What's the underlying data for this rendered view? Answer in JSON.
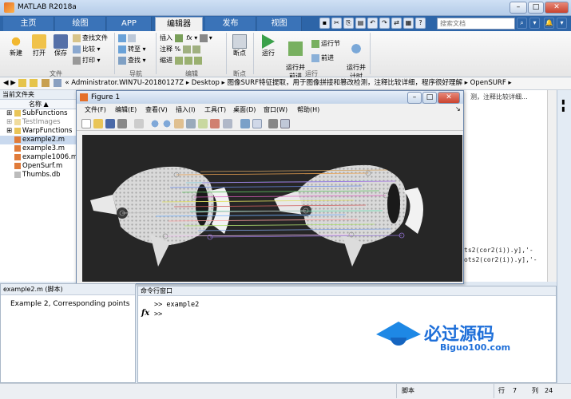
{
  "app": {
    "title": "MATLAB R2018a"
  },
  "tabs": [
    {
      "label": "主页"
    },
    {
      "label": "绘图"
    },
    {
      "label": "APP"
    },
    {
      "label": "编辑器"
    },
    {
      "label": "发布"
    },
    {
      "label": "视图"
    }
  ],
  "search": {
    "placeholder": "搜索文档"
  },
  "ribbon": {
    "file": {
      "new": "新建",
      "open": "打开",
      "save": "保存",
      "find_files": "查找文件",
      "compare": "比较",
      "print": "打印",
      "group": "文件"
    },
    "nav": {
      "goto": "转至",
      "find": "查找",
      "group": "导航"
    },
    "edit": {
      "insert": "插入",
      "comment": "注释",
      "indent": "缩进",
      "fx": "fx",
      "percent": "%",
      "group": "编辑"
    },
    "breakpoint": {
      "label": "断点",
      "group": "断点"
    },
    "run": {
      "run": "运行",
      "run_advance": "运行并\n前进",
      "run_section": "运行节",
      "advance": "前进",
      "run_time": "运行并\n计时",
      "group": "运行"
    }
  },
  "path": {
    "text": "« Administrator.WIN7U-20180127Z  ▸  Desktop  ▸  图像SURF特征提取，用于图像拼接和篡改检测，注释比较详细，程序很好理解  ▸  OpenSURF  ▸"
  },
  "filepanel": {
    "header": "当前文件夹",
    "col": "名称 ▲",
    "items": [
      {
        "name": "SubFunctions",
        "type": "folder"
      },
      {
        "name": "TestImages",
        "type": "folder-dim"
      },
      {
        "name": "WarpFunctions",
        "type": "folder"
      },
      {
        "name": "example2.m",
        "type": "m"
      },
      {
        "name": "example3.m",
        "type": "m"
      },
      {
        "name": "example1006.m",
        "type": "m"
      },
      {
        "name": "OpenSurf.m",
        "type": "m"
      },
      {
        "name": "Thumbs.db",
        "type": "db"
      }
    ]
  },
  "figure": {
    "title": "Figure 1",
    "menu": [
      "文件(F)",
      "编辑(E)",
      "查看(V)",
      "插入(I)",
      "工具(T)",
      "桌面(D)",
      "窗口(W)",
      "帮助(H)"
    ]
  },
  "editor": {
    "frag1": "测，注释比较详细...",
    "frag2": "ts2(cor2(i)).y],'-",
    "frag3": "ots2(cor2(i)).y],'-"
  },
  "detail": {
    "header": "example2.m  (脚本)",
    "text": "Example 2, Corresponding points"
  },
  "cmd": {
    "header": "命令行窗口",
    "line1": ">> example2",
    "prompt": ">>",
    "fx": "fx"
  },
  "watermark": {
    "main": "必过源码",
    "sub": "Biguo100.com"
  },
  "status": {
    "type": "脚本",
    "row_label": "行",
    "row": "7",
    "col_label": "列",
    "col": "24"
  },
  "colors": {
    "accent": "#2d65a8",
    "plot_bg": "#262626"
  }
}
